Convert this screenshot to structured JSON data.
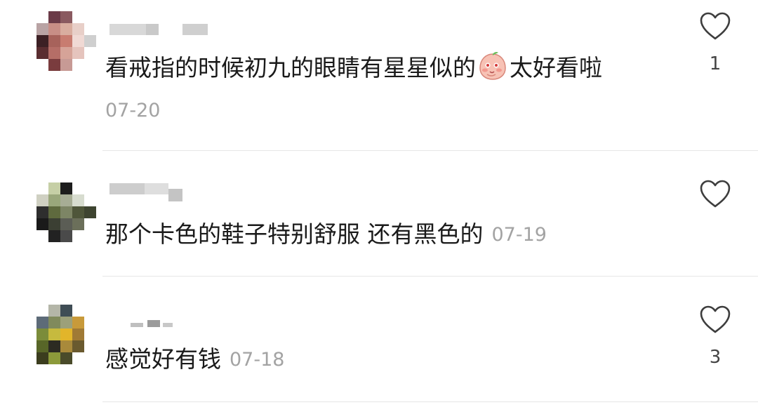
{
  "comments": [
    {
      "text_before": "看戒指的时候初九的眼睛有星星似的",
      "emoji": "blushing-peach-emoji",
      "text_after": "太好看啦",
      "date": "07-20",
      "likes": "1"
    },
    {
      "text": "那个卡色的鞋子特别舒服 还有黑色的",
      "date": "07-19",
      "likes": ""
    },
    {
      "text": "感觉好有钱",
      "date": "07-18",
      "likes": "3"
    }
  ],
  "icons": {
    "like": "heart-outline-icon"
  }
}
